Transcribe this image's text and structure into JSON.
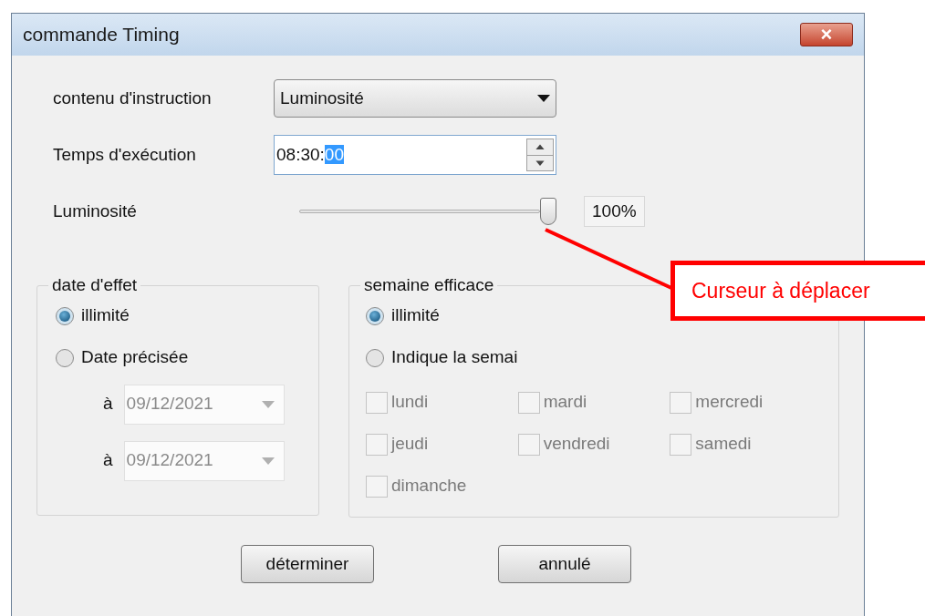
{
  "window": {
    "title": "commande Timing",
    "close_icon": "×"
  },
  "form": {
    "instruction": {
      "label": "contenu d'instruction",
      "value": "Luminosité"
    },
    "time": {
      "label": "Temps d'exécution",
      "value_start": "08:30:",
      "value_selected": "00"
    },
    "brightness": {
      "label": "Luminosité",
      "level": 1,
      "reading": "100%"
    }
  },
  "date_group": {
    "title": "date d'effet",
    "options": [
      {
        "label": "illimité",
        "selected": true
      },
      {
        "label": "Date précisée",
        "selected": false
      }
    ],
    "dates": [
      {
        "prefix": "à",
        "value": "09/12/2021",
        "disabled": true
      },
      {
        "prefix": "à",
        "value": "09/12/2021",
        "disabled": true
      }
    ]
  },
  "week_group": {
    "title": "semaine efficace",
    "options": [
      {
        "label": "illimité",
        "selected": true
      },
      {
        "label": "Indique la semai",
        "selected": false
      }
    ],
    "days": [
      {
        "label": "lundi",
        "checked": false,
        "disabled": true
      },
      {
        "label": "mardi",
        "checked": false,
        "disabled": true
      },
      {
        "label": "mercredi",
        "checked": false,
        "disabled": true
      },
      {
        "label": "jeudi",
        "checked": false,
        "disabled": true
      },
      {
        "label": "vendredi",
        "checked": false,
        "disabled": true
      },
      {
        "label": "samedi",
        "checked": false,
        "disabled": true
      },
      {
        "label": "dimanche",
        "checked": false,
        "disabled": true
      }
    ]
  },
  "buttons": [
    "déterminer",
    "annulé"
  ],
  "annotation": {
    "text": "Curseur à déplacer"
  }
}
